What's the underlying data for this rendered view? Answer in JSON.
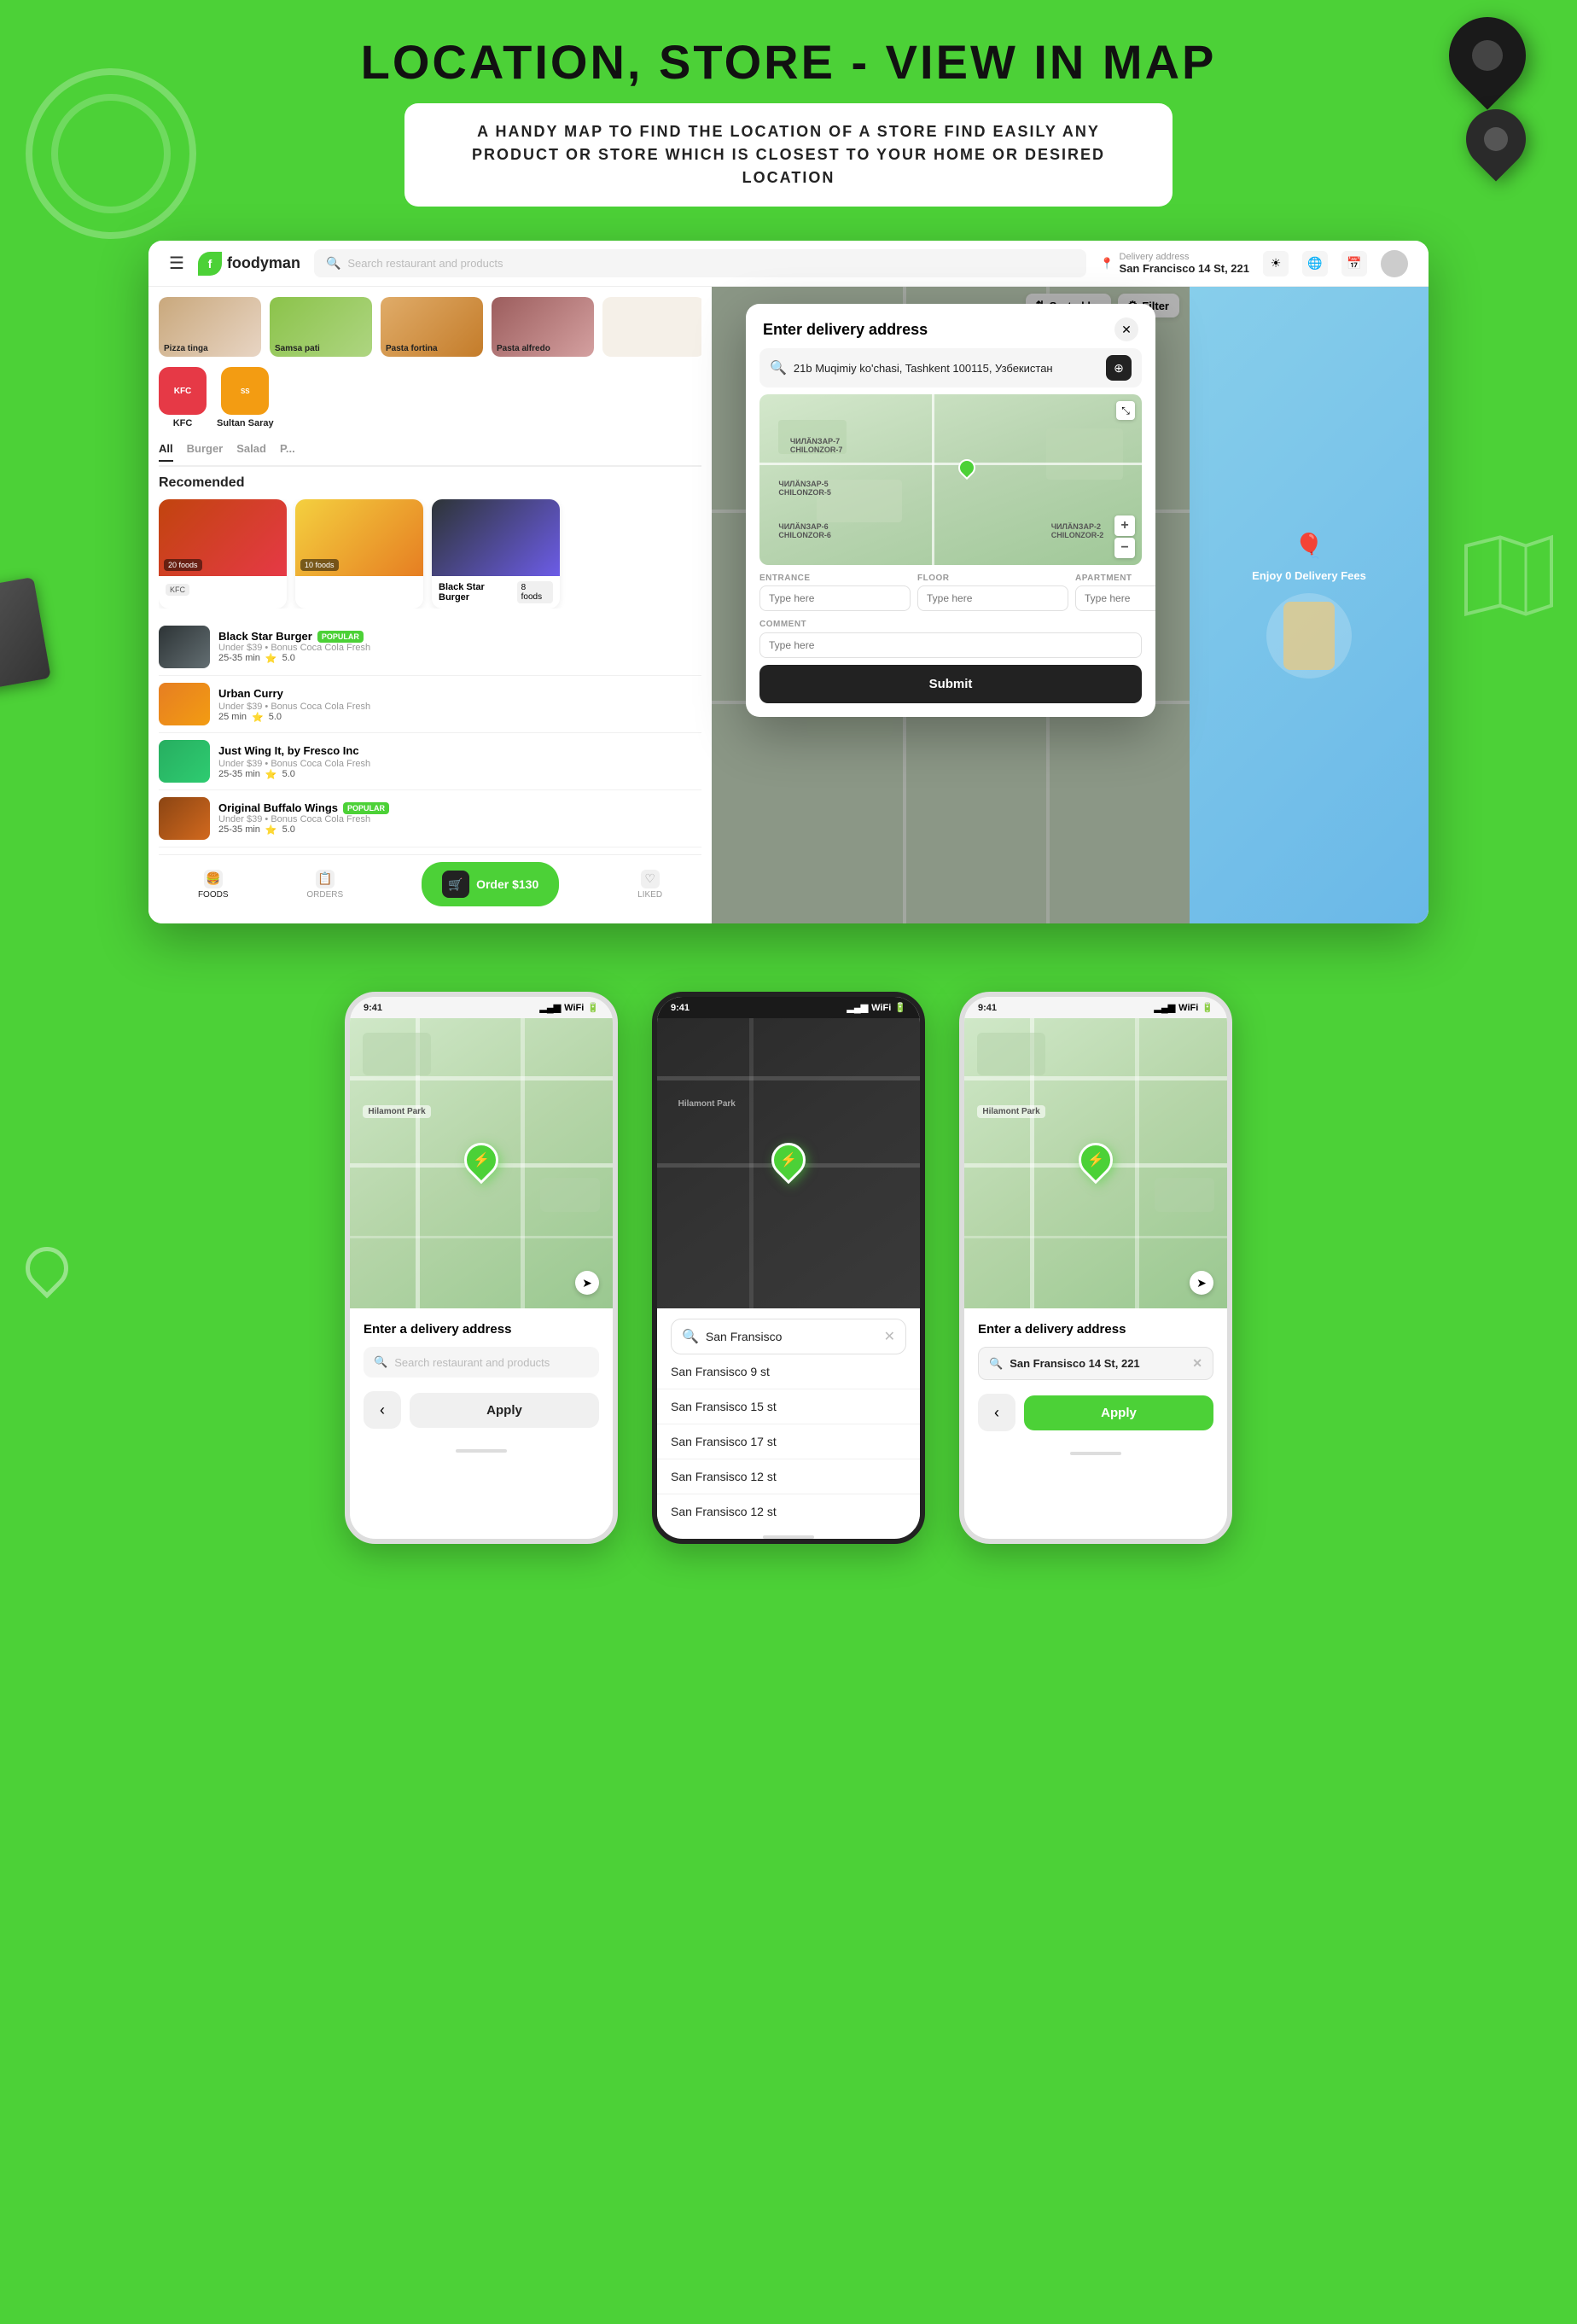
{
  "hero": {
    "title": "LOCATION, STORE - VIEW IN MAP",
    "subtitle": "A HANDY MAP TO FIND THE LOCATION OF A STORE FIND EASILY ANY PRODUCT OR STORE WHICH IS CLOSEST TO YOUR HOME OR DESIRED LOCATION"
  },
  "navbar": {
    "logo": "foodyman",
    "search_placeholder": "Search restaurant and products",
    "delivery_label": "Delivery address",
    "delivery_address": "San Francisco 14 St, 221",
    "sort_label": "Sorted by",
    "filter_label": "Filter"
  },
  "modal": {
    "title": "Enter delivery address",
    "address_value": "21b Muqimiy ko'chasi, Tashkent 100115, Узбекистан",
    "fields": {
      "entrance_label": "ENTRANCE",
      "entrance_placeholder": "Type here",
      "floor_label": "FLOOR",
      "floor_placeholder": "Type here",
      "apartment_label": "APARTMENT",
      "apartment_placeholder": "Type here",
      "comment_label": "COMMENT",
      "comment_placeholder": "Type here"
    },
    "submit_label": "Submit"
  },
  "tabs": [
    "All",
    "Burger",
    "Salad",
    "P..."
  ],
  "categories": [
    {
      "label": "Pizza tinga"
    },
    {
      "label": "Samsa pati"
    },
    {
      "label": "Pasta fortina"
    },
    {
      "label": "Pasta alfredo"
    }
  ],
  "restaurants_top": [
    {
      "name": "KFC",
      "color": "#e63946"
    },
    {
      "name": "Sultan Saray",
      "color": "#8bc34a"
    }
  ],
  "recommended_title": "Recomended",
  "food_cards": [
    {
      "name": "KFC",
      "count": "20 foods"
    },
    {
      "name": "",
      "count": "10 foods"
    }
  ],
  "restaurant_list": [
    {
      "name": "Black Star Burger",
      "sub": "Under $39 • Bonus Coca Cola Fresh",
      "time": "25-35 min",
      "rating": "5.0",
      "popular": true,
      "color": "#2d3436"
    },
    {
      "name": "Urban Curry",
      "sub": "Under $39 • Bonus Coca Cola Fresh",
      "time": "25 min",
      "rating": "5.0",
      "popular": false,
      "color": "#e67e22"
    },
    {
      "name": "Just Wing It, by Fresco Inc",
      "sub": "Under $39 • Bonus Coca Cola Fresh",
      "time": "25-35 min",
      "rating": "5.0",
      "popular": false,
      "color": "#27ae60"
    },
    {
      "name": "Original Buffalo Wings",
      "sub": "Under $39 • Bonus Coca Cola Fresh",
      "time": "25-35 min",
      "rating": "5.0",
      "popular": true,
      "color": "#8b4513"
    }
  ],
  "bottom_nav": [
    {
      "label": "FOODS",
      "icon": "🍔",
      "active": true
    },
    {
      "label": "ORDERS",
      "icon": "📋",
      "active": false
    },
    {
      "label": "LIKED",
      "icon": "♡",
      "active": false
    }
  ],
  "order_btn": "Order $130",
  "mobile_screens": [
    {
      "id": "screen1",
      "time": "9:41",
      "panel_title": "Enter a delivery address",
      "search_placeholder": "Search restaurant and products",
      "back_label": "‹",
      "apply_label": "Apply",
      "apply_active": false,
      "has_results": false,
      "address_value": ""
    },
    {
      "id": "screen2",
      "time": "9:41",
      "search_value": "San Fransisco",
      "results": [
        "San Fransisco 9 st",
        "San Fransisco 15 st",
        "San Fransisco 17 st",
        "San Fransisco 12 st",
        "San Fransisco 12 st"
      ],
      "has_results": true,
      "address_value": "San Fransisco"
    },
    {
      "id": "screen3",
      "time": "9:41",
      "panel_title": "Enter a delivery address",
      "address_filled": "San Fransisco 14 St, 221",
      "back_label": "‹",
      "apply_label": "Apply",
      "apply_active": true,
      "has_results": false
    }
  ]
}
